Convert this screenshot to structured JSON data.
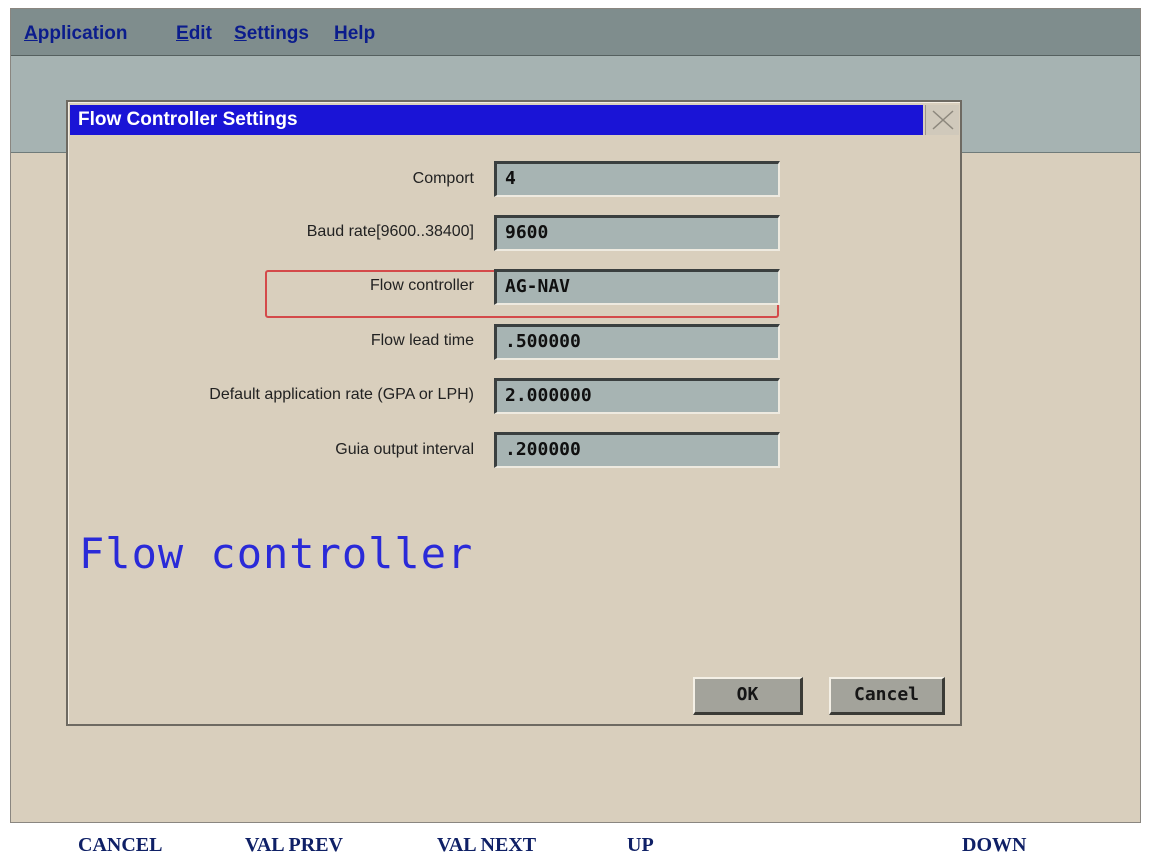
{
  "menu": {
    "items": [
      {
        "label": "Application"
      },
      {
        "label": "Edit"
      },
      {
        "label": "Settings"
      },
      {
        "label": "Help"
      }
    ]
  },
  "dialog": {
    "title": "Flow Controller Settings",
    "fields": [
      {
        "label": "Comport",
        "value": "4"
      },
      {
        "label": "Baud rate[9600..38400]",
        "value": "9600"
      },
      {
        "label": "Flow controller",
        "value": "AG-NAV"
      },
      {
        "label": "Flow lead time",
        "value": ".500000"
      },
      {
        "label": "Default application rate (GPA or LPH)",
        "value": "2.000000"
      },
      {
        "label": "Guia output interval",
        "value": ".200000"
      }
    ],
    "focused_field_name": "Flow controller",
    "ok_label": "OK",
    "cancel_label": "Cancel"
  },
  "function_keys": [
    {
      "label": "CANCEL"
    },
    {
      "label": "VAL PREV"
    },
    {
      "label": "VAL NEXT"
    },
    {
      "label": "UP"
    },
    {
      "label": "DOWN"
    }
  ],
  "colors": {
    "title_bar": "#1a14d6",
    "focused_label": "#2a2ad8",
    "highlight_outline": "#d44a4a",
    "menu_text": "#0b1c8c"
  },
  "icons": {
    "close": "close-icon"
  }
}
